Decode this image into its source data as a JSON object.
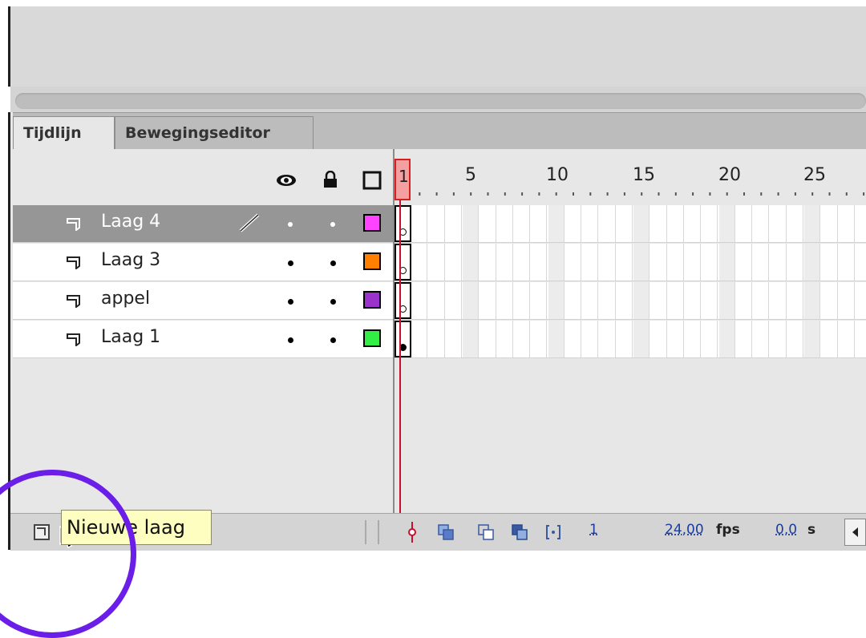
{
  "tabs": [
    {
      "label": "Tijdlijn",
      "active": true
    },
    {
      "label": "Bewegingseditor",
      "active": false
    }
  ],
  "header_icons": [
    "eye-icon",
    "lock-icon",
    "outline-icon"
  ],
  "ruler": {
    "playhead_frame": "1",
    "labels": [
      "5",
      "10",
      "15",
      "20",
      "25"
    ]
  },
  "layers": [
    {
      "name": "Laag 4",
      "selected": true,
      "color": "#ff44ff",
      "pencil": true,
      "keyframe": "empty"
    },
    {
      "name": "Laag 3",
      "selected": false,
      "color": "#ff8000",
      "pencil": false,
      "keyframe": "empty"
    },
    {
      "name": "appel",
      "selected": false,
      "color": "#9933cc",
      "pencil": false,
      "keyframe": "empty"
    },
    {
      "name": "Laag 1",
      "selected": false,
      "color": "#33ee44",
      "pencil": false,
      "keyframe": "filled"
    }
  ],
  "bottom_bar": {
    "current_frame": "1",
    "fps_value": "24,00",
    "fps_unit": "fps",
    "time_value": "0,0",
    "time_unit": "s"
  },
  "tooltip": "Nieuwe laag",
  "colors": {
    "selected_row": "#969696",
    "playhead": "#d42020",
    "annotation_circle": "#6a1ee8"
  }
}
